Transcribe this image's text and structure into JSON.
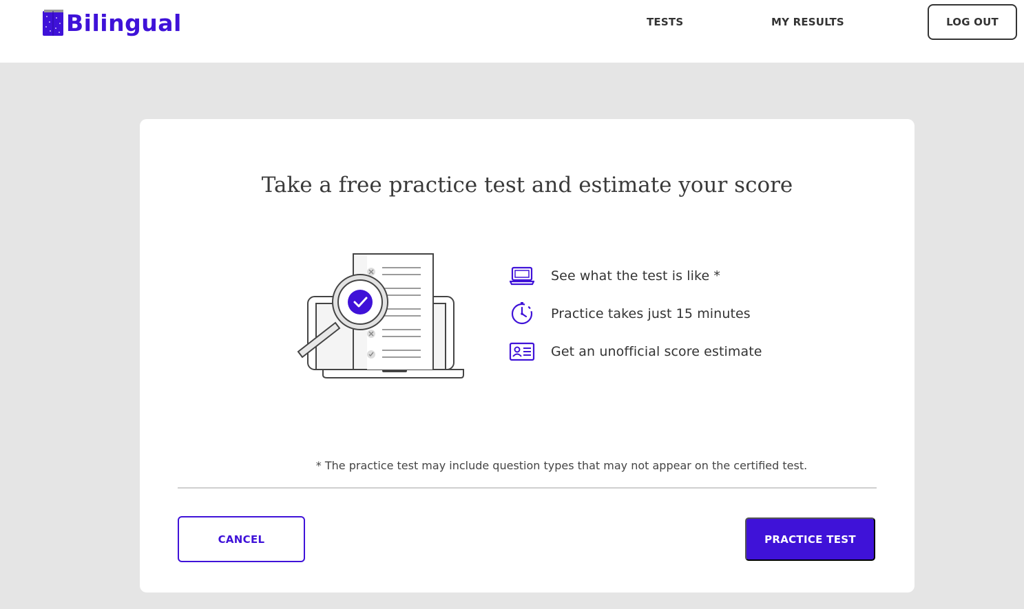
{
  "header": {
    "brand": "Bilingual",
    "nav": {
      "tests": "TESTS",
      "my_results": "MY RESULTS"
    },
    "logout_label": "LOG OUT"
  },
  "card": {
    "title": "Take a free practice test and estimate your score",
    "features": [
      {
        "icon": "laptop-icon",
        "text": "See what the test is like *"
      },
      {
        "icon": "timer-icon",
        "text": "Practice takes just 15 minutes"
      },
      {
        "icon": "id-card-icon",
        "text": "Get an unofficial score estimate"
      }
    ],
    "footnote": "* The practice test may include question types that may not appear on the certified test.",
    "cancel_label": "CANCEL",
    "practice_label": "PRACTICE TEST"
  },
  "colors": {
    "accent": "#3f12d8",
    "page_bg": "#e5e5e5",
    "text": "#333333"
  }
}
